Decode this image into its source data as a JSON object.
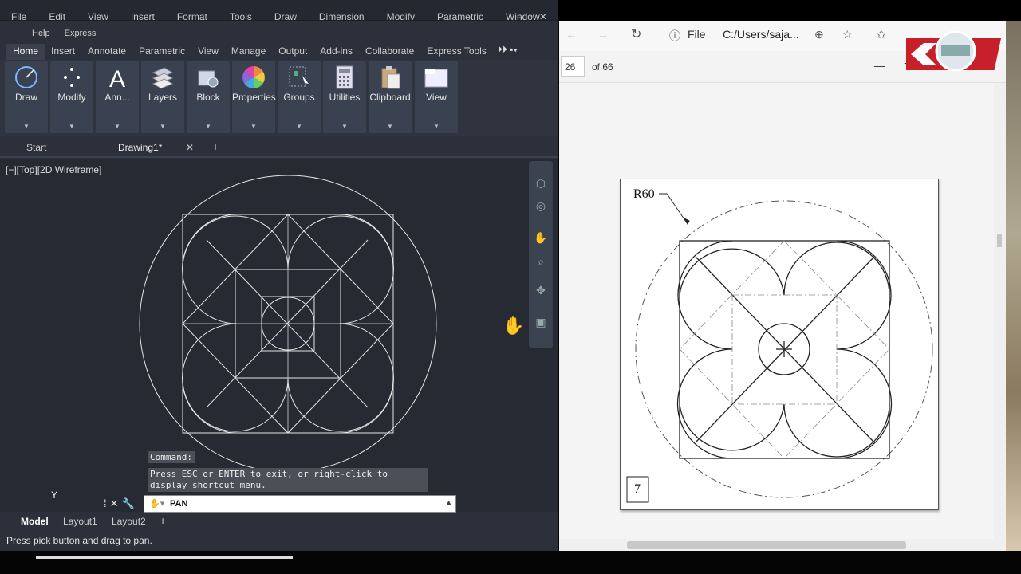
{
  "autocad": {
    "menubar_top": [
      "File",
      "Edit",
      "View",
      "Insert",
      "Format",
      "Tools",
      "Draw",
      "Dimension",
      "Modify",
      "Parametric",
      "Window"
    ],
    "menubar_second": [
      "Help",
      "Express"
    ],
    "ribbon_tabs": [
      "Home",
      "Insert",
      "Annotate",
      "Parametric",
      "View",
      "Manage",
      "Output",
      "Add-ins",
      "Collaborate",
      "Express Tools"
    ],
    "ribbon_panels": [
      {
        "label": "Draw",
        "icon": "draw-icon"
      },
      {
        "label": "Modify",
        "icon": "modify-icon"
      },
      {
        "label": "Ann...",
        "icon": "annotate-icon"
      },
      {
        "label": "Layers",
        "icon": "layers-icon"
      },
      {
        "label": "Block",
        "icon": "block-icon"
      },
      {
        "label": "Properties",
        "icon": "properties-icon"
      },
      {
        "label": "Groups",
        "icon": "groups-icon"
      },
      {
        "label": "Utilities",
        "icon": "utilities-icon"
      },
      {
        "label": "Clipboard",
        "icon": "clipboard-icon"
      },
      {
        "label": "View",
        "icon": "view-icon"
      }
    ],
    "file_tabs": {
      "start": "Start",
      "drawing": "Drawing1*",
      "close": "✕",
      "add": "+"
    },
    "viewport_label": "[−][Top][2D Wireframe]",
    "command_popup": {
      "title": "Command:",
      "message": "Press ESC or ENTER to exit, or right-click to display shortcut menu."
    },
    "command_line": {
      "value": "PAN"
    },
    "ucs_label": "Y",
    "layout_tabs": [
      "Model",
      "Layout1",
      "Layout2",
      "+"
    ],
    "status_text": "Press pick button and drag to pan."
  },
  "browser": {
    "address_prefix": "File",
    "address": "C:/Users/saja...",
    "page_current": "26",
    "page_total": "of 66",
    "zoom_minus": "—",
    "zoom_plus": "+"
  },
  "pdf_figure": {
    "radius_label": "R60",
    "figure_number": "7"
  }
}
